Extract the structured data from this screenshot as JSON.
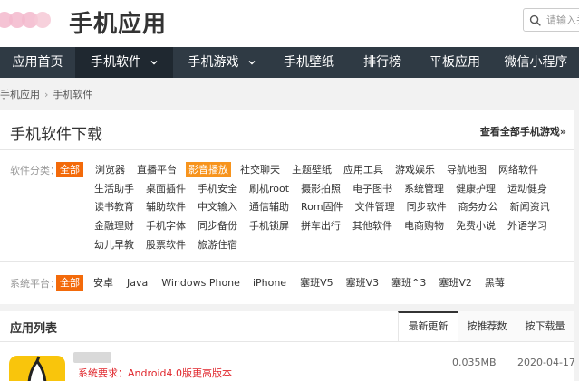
{
  "header": {
    "site_name": "手机应用",
    "search_placeholder": "请输入关"
  },
  "nav": [
    {
      "label": "应用首页"
    },
    {
      "label": "手机软件",
      "active": true
    },
    {
      "label": "手机游戏"
    },
    {
      "label": "手机壁纸"
    },
    {
      "label": "排行榜"
    },
    {
      "label": "平板应用"
    },
    {
      "label": "微信小程序"
    }
  ],
  "breadcrumb": [
    "手机应用",
    "手机软件"
  ],
  "category_panel": {
    "title": "手机软件下载",
    "view_all_link": "查看全部手机游戏»",
    "category_label": "软件分类：",
    "category_rows": [
      [
        "全部",
        "浏览器",
        "直播平台",
        "影音播放",
        "社交聊天",
        "主题壁纸",
        "应用工具",
        "游戏娱乐",
        "导航地图",
        "网络软件"
      ],
      [
        "生活助手",
        "桌面插件",
        "手机安全",
        "刷机root",
        "摄影拍照",
        "电子图书",
        "系统管理",
        "健康护理",
        "运动健身"
      ],
      [
        "读书教育",
        "辅助软件",
        "中文输入",
        "通信辅助",
        "Rom固件",
        "文件管理",
        "同步软件",
        "商务办公",
        "新闻资讯"
      ],
      [
        "金融理财",
        "手机字体",
        "同步备份",
        "手机锁屏",
        "拼车出行",
        "其他软件",
        "电商购物",
        "免费小说",
        "外语学习"
      ],
      [
        "幼儿早教",
        "股票软件",
        "旅游住宿"
      ]
    ],
    "platform_label": "系统平台：",
    "platforms": [
      "全部",
      "安卓",
      "Java",
      "Windows Phone",
      "iPhone",
      "塞班V5",
      "塞班V3",
      "塞班^3",
      "塞班V2",
      "黑莓"
    ]
  },
  "app_list": {
    "title": "应用列表",
    "sort_tabs": [
      {
        "label": "最新更新",
        "active": true
      },
      {
        "label": "按推荐数"
      },
      {
        "label": "按下载量"
      }
    ],
    "items": [
      {
        "requirement": "系统要求：Android4.0版更高版本",
        "size": "0.035MB",
        "date": "2020-04-17"
      }
    ]
  },
  "colors": {
    "nav_bg": "#2f3a44",
    "nav_active_bg": "#1f2830",
    "tag_selected": "#f36a0a",
    "tag_highlight": "#f7941d",
    "requirement_text": "#e0262c",
    "app_icon": "#f9c50c"
  },
  "icons": {
    "search": "search-icon",
    "nav_dropdown": "chevron-down-icon",
    "breadcrumb_separator": "chevron-right-icon"
  }
}
